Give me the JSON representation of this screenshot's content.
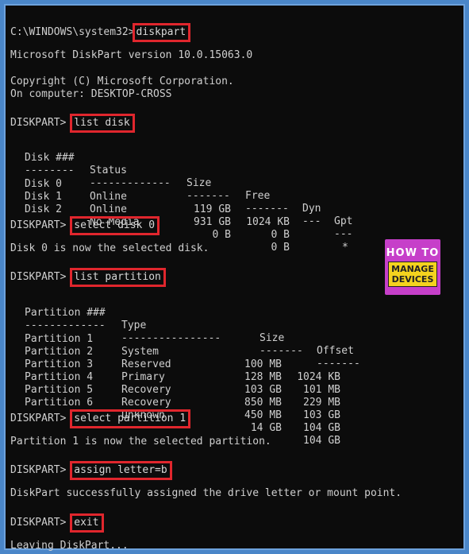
{
  "prompts": {
    "cmd": "C:\\WINDOWS\\system32>",
    "diskpart": "DISKPART>"
  },
  "commands": {
    "diskpart": "diskpart",
    "list_disk": "list disk",
    "select_disk": "select disk 0",
    "list_partition": "list partition",
    "select_partition": "select partition 1",
    "assign_letter": "assign letter=b",
    "exit": "exit"
  },
  "output": {
    "version": "Microsoft DiskPart version 10.0.15063.0",
    "copyright": "Copyright (C) Microsoft Corporation.",
    "computer": "On computer: DESKTOP-CROSS",
    "disk_selected": "Disk 0 is now the selected disk.",
    "partition_selected": "Partition 1 is now the selected partition.",
    "assign_success": "DiskPart successfully assigned the drive letter or mount point.",
    "leaving": "Leaving DiskPart..."
  },
  "disk_table": {
    "headers": [
      "Disk ###",
      "Status",
      "Size",
      "Free",
      "Dyn",
      "Gpt"
    ],
    "separators": [
      "--------",
      "-------------",
      "-------",
      "-------",
      "---",
      "---"
    ],
    "rows": [
      [
        "Disk 0",
        "Online",
        "119 GB",
        "1024 KB",
        "",
        "*"
      ],
      [
        "Disk 1",
        "Online",
        "931 GB",
        "0 B",
        "",
        ""
      ],
      [
        "Disk 2",
        "No Media",
        "0 B",
        "0 B",
        "",
        ""
      ]
    ]
  },
  "partition_table": {
    "headers": [
      "Partition ###",
      "Type",
      "Size",
      "Offset"
    ],
    "separators": [
      "-------------",
      "----------------",
      "-------",
      "-------"
    ],
    "rows": [
      [
        "Partition 1",
        "System",
        "100 MB",
        "1024 KB"
      ],
      [
        "Partition 2",
        "Reserved",
        "128 MB",
        "101 MB"
      ],
      [
        "Partition 3",
        "Primary",
        "103 GB",
        "229 MB"
      ],
      [
        "Partition 4",
        "Recovery",
        "850 MB",
        "103 GB"
      ],
      [
        "Partition 5",
        "Recovery",
        "450 MB",
        "104 GB"
      ],
      [
        "Partition 6",
        "Unknown",
        "14 GB",
        "104 GB"
      ]
    ]
  },
  "logo": {
    "top": "HOW TO",
    "line1": "MANAGE",
    "line2": "DEVICES"
  },
  "colors": {
    "highlight_border": "#e0262d",
    "terminal_bg": "#0c0c0c",
    "frame": "#4a86c8",
    "logo_bg": "#c63fc9",
    "logo_box": "#f4d31e"
  }
}
